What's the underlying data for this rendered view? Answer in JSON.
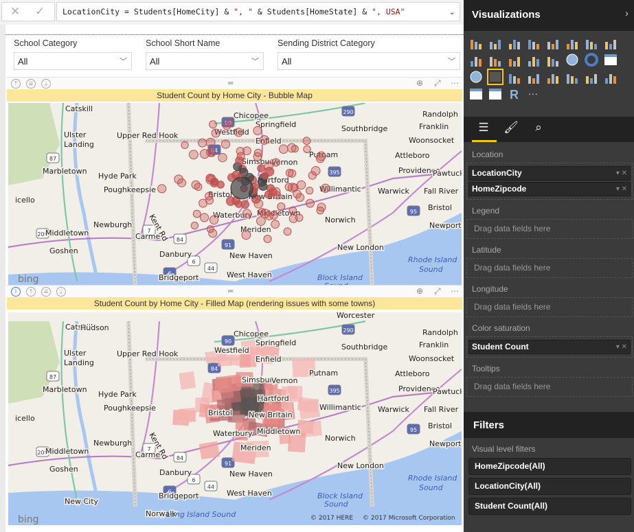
{
  "formula_bar": {
    "cancel_icon": "x-icon",
    "commit_icon": "check-icon",
    "expr_parts": [
      "LocationCity = Students[HomeCity] & ",
      "\", \"",
      " & Students[HomeState] & ",
      "\", USA\""
    ]
  },
  "slicers": [
    {
      "label": "School Category",
      "value": "All"
    },
    {
      "label": "School Short Name",
      "value": "All"
    },
    {
      "label": "Sending District Category",
      "value": "All"
    }
  ],
  "visuals": [
    {
      "title": "Student Count by Home City - Bubble Map"
    },
    {
      "title": "Student Count by Home City - Filled Map (rendering issues with some towns)"
    }
  ],
  "map": {
    "bing_logo": "bing",
    "copyright_here": "© 2017 HERE",
    "copyright_ms": "© 2017 Microsoft Corporation",
    "labels": [
      "Catskill",
      "Ulster",
      "Landing",
      "Upper Red Hook",
      "Marbletown",
      "Hyde Park",
      "Poughkeepsie",
      "Newburgh",
      "Middletown",
      "Goshen",
      "Carmel",
      "Danbury",
      "Bridgeport",
      "Chicopee",
      "Westfield",
      "Springfield",
      "Enfield",
      "Southbridge",
      "Putnam",
      "Simsbury",
      "Vernon",
      "Hartford",
      "Bristol",
      "New Britain",
      "Willimantic",
      "Waterbury",
      "Middletown",
      "Meriden",
      "Norwich",
      "New Haven",
      "New London",
      "West Haven",
      "Providence",
      "Pawtucket",
      "Attleboro",
      "Woonsocket",
      "Franklin",
      "Randolph",
      "Warwick",
      "Fall River",
      "Bristol",
      "Newport",
      "icello",
      "Kent Rd"
    ],
    "sea_labels": [
      "Rhode Island",
      "Sound",
      "Block Island",
      "Sound"
    ],
    "filled_extra_labels": [
      "Hudson",
      "Worcester",
      "New City",
      "Norwalk",
      "Long Island Sound"
    ],
    "highway_shields": [
      "90",
      "290",
      "84",
      "395",
      "95",
      "91",
      "84",
      "7",
      "6",
      "209",
      "87",
      "44",
      "6"
    ],
    "bubble_color": "#c0504d",
    "bubble_dark_color": "#444444"
  },
  "visualizations": {
    "title": "Visualizations",
    "icons": [
      "stacked-bar-icon",
      "stacked-column-icon",
      "clustered-bar-icon",
      "clustered-column-icon",
      "100-stacked-bar-icon",
      "100-stacked-column-icon",
      "line-chart-icon",
      "area-chart-icon",
      "stacked-area-icon",
      "line-column-icon",
      "line-clustered-column-icon",
      "ribbon-chart-icon",
      "scatter-icon",
      "pie-icon",
      "donut-icon",
      "treemap-icon",
      "globe-map-icon",
      "filled-map-icon",
      "funnel-icon",
      "gauge-icon",
      "card-icon",
      "multirow-card-icon",
      "kpi-icon",
      "slicer-icon",
      "table-icon",
      "matrix-icon",
      "r-visual-icon",
      "more-icon"
    ],
    "selected": "filled-map-icon",
    "tabs": [
      "fields-tab-icon",
      "format-paint-roller-icon",
      "analytics-icon"
    ]
  },
  "wells": [
    {
      "label": "Location",
      "fields": [
        "LocationCity",
        "HomeZipcode"
      ]
    },
    {
      "label": "Legend",
      "placeholder": "Drag data fields here"
    },
    {
      "label": "Latitude",
      "placeholder": "Drag data fields here"
    },
    {
      "label": "Longitude",
      "placeholder": "Drag data fields here"
    },
    {
      "label": "Color saturation",
      "fields": [
        "Student Count"
      ]
    },
    {
      "label": "Tooltips",
      "placeholder": "Drag data fields here"
    }
  ],
  "filters": {
    "title": "Filters",
    "section": "Visual level filters",
    "items": [
      "HomeZipcode(All)",
      "LocationCity(All)",
      "Student Count(All)"
    ]
  },
  "accent": "#f2c811"
}
